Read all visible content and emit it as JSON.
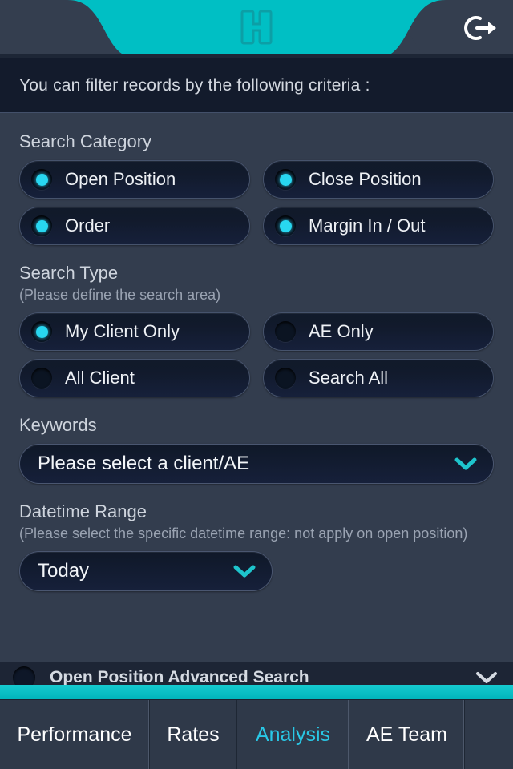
{
  "header": {
    "logo_icon": "h-logo-icon",
    "logout_icon": "logout-icon",
    "accent_color": "#00bfc4",
    "bar_color": "#343e4f"
  },
  "info_banner": {
    "text": "You can filter records by the following criteria :"
  },
  "search_category": {
    "label": "Search Category",
    "options": [
      {
        "label": "Open Position",
        "selected": true
      },
      {
        "label": "Close Position",
        "selected": true
      },
      {
        "label": "Order",
        "selected": true
      },
      {
        "label": "Margin In / Out",
        "selected": true
      }
    ]
  },
  "search_type": {
    "label": "Search Type",
    "sublabel": "(Please define the search area)",
    "options": [
      {
        "label": "My Client Only",
        "selected": true
      },
      {
        "label": "AE Only",
        "selected": false
      },
      {
        "label": "All Client",
        "selected": false
      },
      {
        "label": "Search All",
        "selected": false
      }
    ]
  },
  "keywords": {
    "label": "Keywords",
    "value": "Please select a client/AE",
    "chevron_icon": "chevron-down-icon"
  },
  "datetime_range": {
    "label": "Datetime Range",
    "sublabel": "(Please select the specific datetime range: not apply on open position)",
    "value": "Today",
    "chevron_icon": "chevron-down-icon"
  },
  "advanced_search": {
    "label": "Open Position Advanced Search",
    "selected": false,
    "chevron_icon": "chevron-down-icon"
  },
  "tabbar": {
    "tabs": [
      {
        "label": "Performance",
        "active": false
      },
      {
        "label": "Rates",
        "active": false
      },
      {
        "label": "Analysis",
        "active": true
      },
      {
        "label": "AE Team",
        "active": false
      },
      {
        "label": "",
        "active": false
      }
    ],
    "active_color": "#29c8e6"
  }
}
